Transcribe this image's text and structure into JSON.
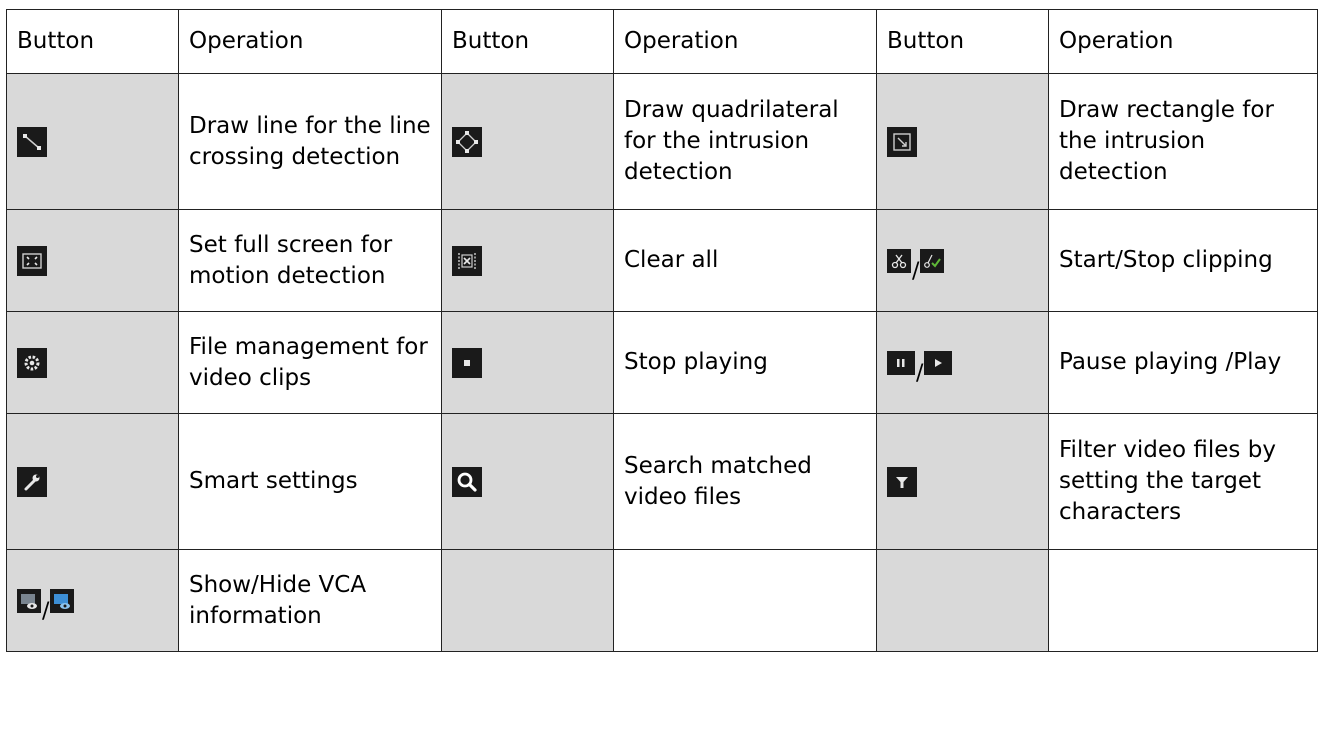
{
  "table": {
    "header": [
      "Button",
      "Operation",
      "Button",
      "Operation",
      "Button",
      "Operation"
    ],
    "rows": [
      [
        {
          "icons": [
            "draw-line-icon"
          ],
          "op": "Draw line for the line crossing detection"
        },
        {
          "icons": [
            "draw-quadrilateral-icon"
          ],
          "op": "Draw quadrilateral for the intrusion detection"
        },
        {
          "icons": [
            "draw-rectangle-icon"
          ],
          "op": "Draw rectangle for the intrusion detection"
        }
      ],
      [
        {
          "icons": [
            "full-screen-icon"
          ],
          "op": "Set full screen for motion detection"
        },
        {
          "icons": [
            "clear-all-icon"
          ],
          "op": "Clear all"
        },
        {
          "icons": [
            "start-clipping-icon",
            "stop-clipping-icon"
          ],
          "sep": "/",
          "op": "Start/Stop clipping"
        }
      ],
      [
        {
          "icons": [
            "file-management-icon"
          ],
          "op": "File management for video clips"
        },
        {
          "icons": [
            "stop-icon"
          ],
          "op": "Stop playing"
        },
        {
          "icons": [
            "pause-icon",
            "play-icon"
          ],
          "sep": "/",
          "op": "Pause playing /Play"
        }
      ],
      [
        {
          "icons": [
            "wrench-icon"
          ],
          "op": "Smart settings"
        },
        {
          "icons": [
            "search-icon"
          ],
          "op": "Search matched video files"
        },
        {
          "icons": [
            "filter-icon"
          ],
          "op": "Filter video files by setting the target characters"
        }
      ],
      [
        {
          "icons": [
            "show-vca-icon",
            "hide-vca-icon"
          ],
          "sep": "/",
          "op": "Show/Hide VCA information"
        },
        {
          "icons": [],
          "op": ""
        },
        {
          "icons": [],
          "op": ""
        }
      ]
    ]
  },
  "colors": {
    "button_cell_bg": "#d9d9d9",
    "icon_bg": "#1a1a1a",
    "icon_fg": "#e8e8e8",
    "icon_green": "#5fb838",
    "icon_blue": "#3d8fd6"
  }
}
